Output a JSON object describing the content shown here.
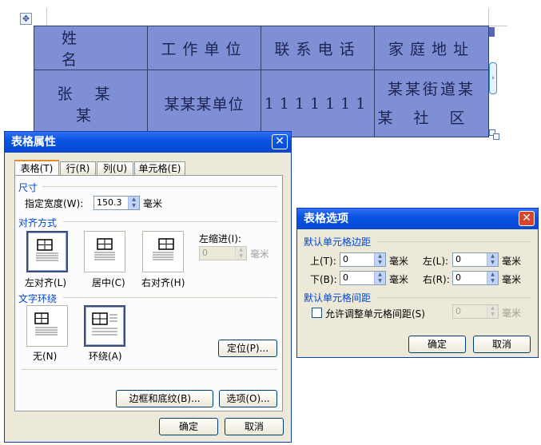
{
  "document": {
    "table": {
      "headers": [
        "姓名",
        "工作单位",
        "联系电话",
        "家庭地址"
      ],
      "row": [
        "张某某",
        "某某某单位",
        "1111111"
      ],
      "address_lines": [
        "某某街道某",
        "某社区"
      ]
    }
  },
  "table_properties": {
    "title": "表格属性",
    "close": "✕",
    "tabs": [
      "表格(T)",
      "行(R)",
      "列(U)",
      "单元格(E)"
    ],
    "size_group": "尺寸",
    "width_label": "指定宽度(W):",
    "width_value": "150.3",
    "width_unit": "毫米",
    "align_group": "对齐方式",
    "align_left": "左对齐(L)",
    "align_center": "居中(C)",
    "align_right": "右对齐(H)",
    "indent_label": "左缩进(I):",
    "indent_value": "0",
    "indent_unit": "毫米",
    "wrap_group": "文字环绕",
    "wrap_none": "无(N)",
    "wrap_around": "环绕(A)",
    "position_button": "定位(P)...",
    "borders_button": "边框和底纹(B)...",
    "options_button": "选项(O)...",
    "ok": "确定",
    "cancel": "取消"
  },
  "table_options": {
    "title": "表格选项",
    "close": "✕",
    "margins_group": "默认单元格边距",
    "top_label": "上(T):",
    "top_value": "0",
    "left_label": "左(L):",
    "left_value": "0",
    "bottom_label": "下(B):",
    "bottom_value": "0",
    "right_label": "右(R):",
    "right_value": "0",
    "unit": "毫米",
    "spacing_group": "默认单元格间距",
    "allow_spacing_label": "允许调整单元格间距(S)",
    "allow_spacing_checked": false,
    "spacing_value": "0",
    "ok": "确定",
    "cancel": "取消"
  }
}
